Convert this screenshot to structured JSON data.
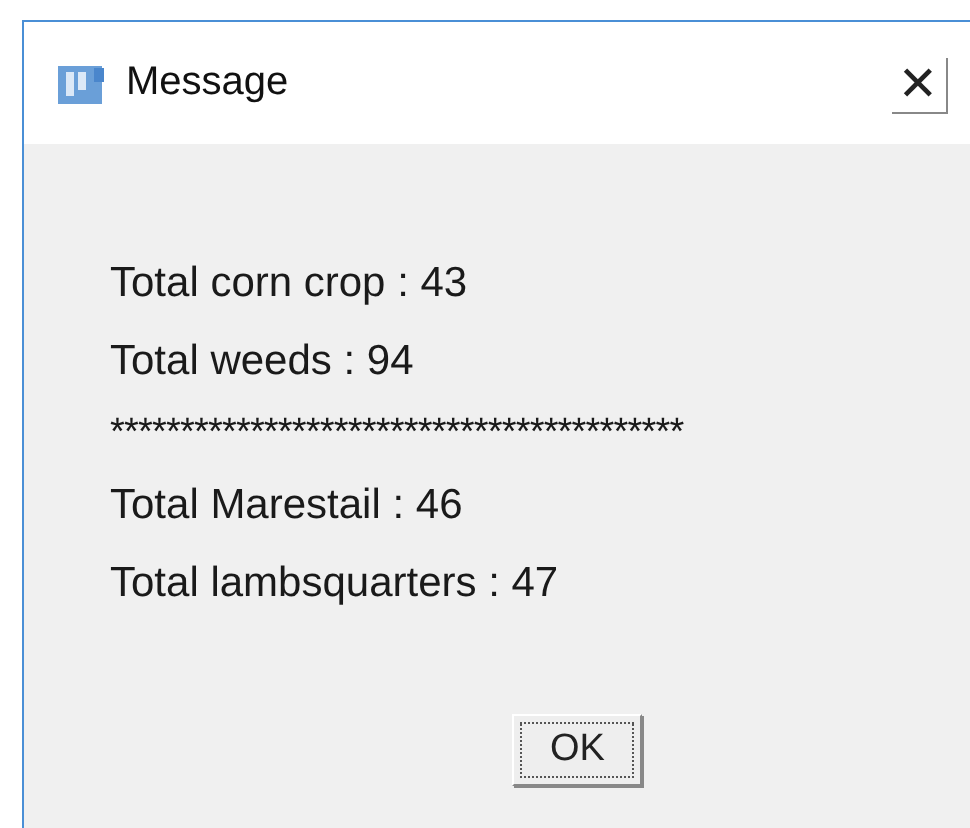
{
  "window": {
    "title": "Message",
    "close": "✕"
  },
  "lines": [
    "Total corn crop : 43",
    "Total weeds : 94",
    "*****************************************",
    "Total Marestail : 46",
    "Total lambsquarters : 47"
  ],
  "buttons": [
    {
      "label": "OK",
      "focused": true
    }
  ]
}
